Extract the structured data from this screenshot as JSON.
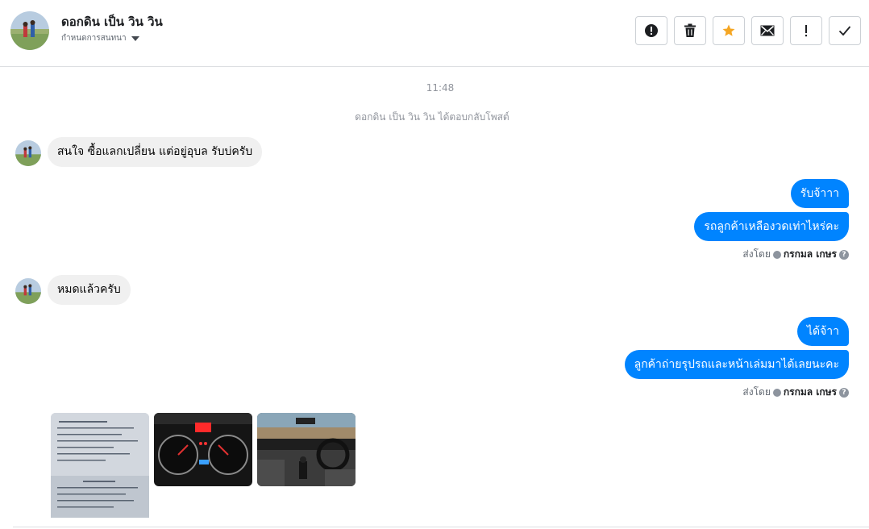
{
  "header": {
    "contact_name": "ดอกดิน เป็น วิน วิน",
    "assign_label": "กำหนดการสนทนา",
    "actions": [
      {
        "name": "spam",
        "icon": "alert-circle-icon"
      },
      {
        "name": "delete",
        "icon": "trash-icon"
      },
      {
        "name": "star",
        "icon": "star-icon",
        "color": "#f5a623"
      },
      {
        "name": "mark-unread",
        "icon": "envelope-icon"
      },
      {
        "name": "follow-up",
        "icon": "exclamation-icon"
      },
      {
        "name": "done",
        "icon": "check-icon"
      }
    ]
  },
  "conversation": {
    "timestamp": "11:48",
    "system_note": "ดอกดิน เป็น วิน วิน ได้ตอบกลับโพสต์",
    "messages": [
      {
        "direction": "incoming",
        "text": "สนใจ ซื้อแลกเปลี่ยน แต่อยู่อุบล รับบ่ครับ"
      },
      {
        "direction": "outgoing",
        "text": "รับจ้าาา"
      },
      {
        "direction": "outgoing",
        "text": "รถลูกค้าเหลืองวดเท่าไหร่คะ"
      },
      {
        "direction": "incoming",
        "text": "หมดแล้วครับ"
      },
      {
        "direction": "outgoing",
        "text": "ได้จ้าา"
      },
      {
        "direction": "outgoing",
        "text": "ลูกค้าถ่ายรุปรถและหน้าเล่มมาได้เลยนะคะ"
      }
    ],
    "sent_by": {
      "prefix": "ส่งโดย",
      "sender": "กรกมล เกษร",
      "help": "?"
    },
    "attachments": [
      {
        "name": "document-photo",
        "icon": "vehicle-registration-image"
      },
      {
        "name": "dashboard-photo",
        "icon": "dashboard-gauges-image"
      },
      {
        "name": "interior-photo",
        "icon": "car-interior-image"
      }
    ]
  },
  "colors": {
    "outgoing_bubble": "#0084ff",
    "incoming_bubble": "#f0f0f0",
    "star": "#f5a623"
  }
}
